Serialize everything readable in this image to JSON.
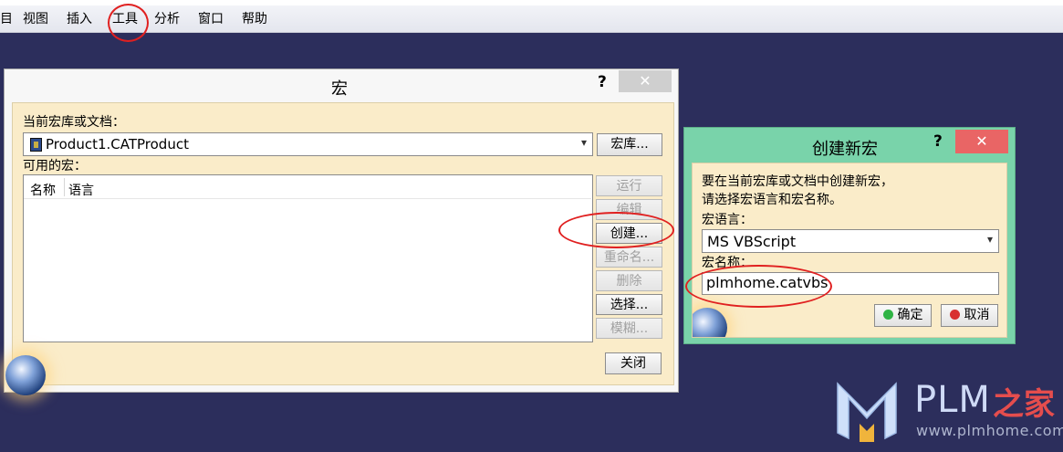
{
  "menubar": {
    "items": [
      "目",
      "视图",
      "插入",
      "工具",
      "分析",
      "窗口",
      "帮助"
    ]
  },
  "macro_dialog": {
    "title": "宏",
    "help_label": "?",
    "close_label": "✕",
    "library_label": "当前宏库或文档：",
    "library_value": "Product1.CATProduct",
    "library_button": "宏库...",
    "available_label": "可用的宏：",
    "list_columns": [
      "名称",
      "语言"
    ],
    "buttons": {
      "run": "运行",
      "edit": "编辑",
      "create": "创建...",
      "rename": "重命名...",
      "delete": "删除",
      "select": "选择...",
      "template": "模糊...",
      "close": "关闭"
    }
  },
  "create_dialog": {
    "title": "创建新宏",
    "help_label": "?",
    "close_label": "✕",
    "instruction_line1": "要在当前宏库或文档中创建新宏，",
    "instruction_line2": "请选择宏语言和宏名称。",
    "language_label": "宏语言：",
    "language_value": "MS VBScript",
    "name_label": "宏名称：",
    "name_value": "plmhome.catvbs",
    "ok_label": "确定",
    "cancel_label": "取消",
    "ok_color": "#2fb344",
    "cancel_color": "#d83030"
  },
  "watermark": {
    "logo": "PLM",
    "logo_cn": "之家",
    "url": "www.plmhome.com"
  }
}
